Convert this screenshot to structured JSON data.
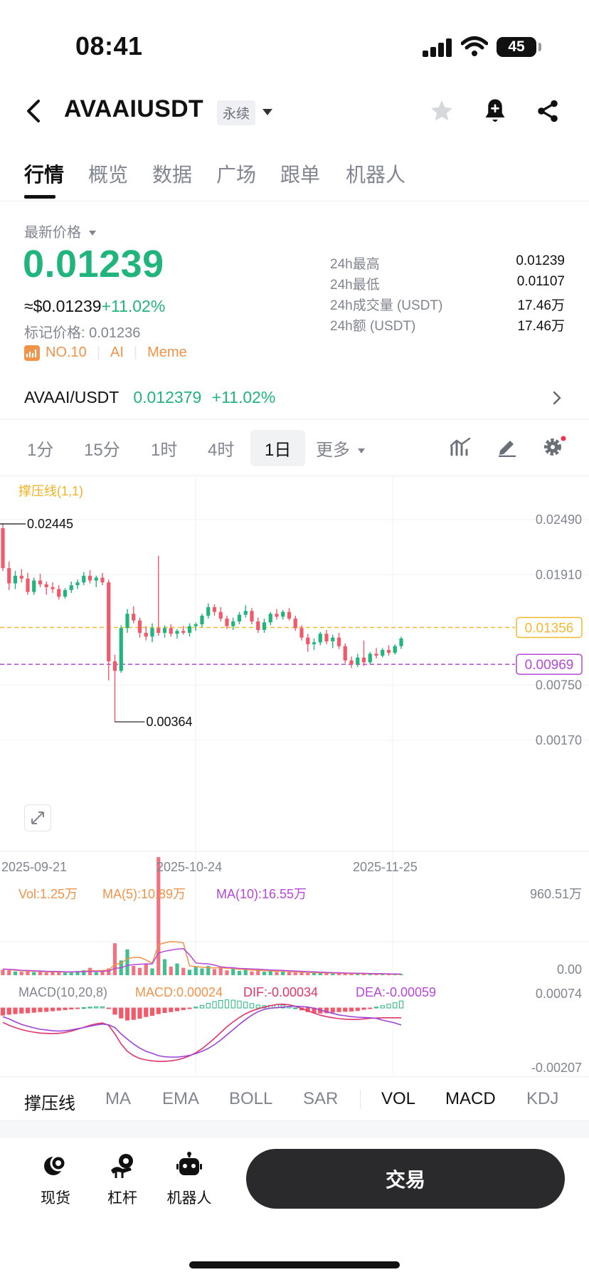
{
  "status": {
    "time": "08:41",
    "battery": "45"
  },
  "header": {
    "title": "AVAAIUSDT",
    "badge": "永续"
  },
  "tabs": [
    {
      "label": "行情"
    },
    {
      "label": "概览"
    },
    {
      "label": "数据"
    },
    {
      "label": "广场"
    },
    {
      "label": "跟单"
    },
    {
      "label": "机器人"
    }
  ],
  "price": {
    "label": "最新价格",
    "last": "0.01239",
    "usd": "≈$0.01239",
    "change": "+11.02%",
    "mark": "标记价格: 0.01236",
    "rank": "NO.10",
    "tag1": "AI",
    "tag2": "Meme"
  },
  "stats": [
    {
      "label": "24h最高",
      "value": "0.01239"
    },
    {
      "label": "24h最低",
      "value": "0.01107"
    },
    {
      "label": "24h成交量 (USDT)",
      "value": "17.46万"
    },
    {
      "label": "24h额 (USDT)",
      "value": "17.46万"
    }
  ],
  "spot": {
    "pair": "AVAAI/USDT",
    "price": "0.012379",
    "change": "+11.02%"
  },
  "timeframes": [
    {
      "label": "1分"
    },
    {
      "label": "15分"
    },
    {
      "label": "1时"
    },
    {
      "label": "4时"
    },
    {
      "label": "1日"
    },
    {
      "label": "更多"
    }
  ],
  "colors": {
    "up": "#21b47d",
    "down": "#f05a6a",
    "resistance": "#f5b82e",
    "support": "#b548d8"
  },
  "chart_data": {
    "type": "candlestick",
    "indicator_label": "撑压线(1,1)",
    "y_ticks": [
      "0.02490",
      "0.01910",
      "0.00750",
      "0.00170"
    ],
    "x_ticks": [
      "2025-09-21",
      "2025-10-24",
      "2025-11-25"
    ],
    "ylim": [
      0.0017,
      0.0249
    ],
    "high_label": "0.02445",
    "low_label": "0.00364",
    "resistance": 0.01356,
    "resistance_label": "0.01356",
    "support": 0.00969,
    "support_label": "0.00969",
    "candles": [
      [
        0.024,
        0.0245,
        0.0195,
        0.0198
      ],
      [
        0.0198,
        0.0205,
        0.0175,
        0.0182
      ],
      [
        0.0182,
        0.0195,
        0.0176,
        0.019
      ],
      [
        0.019,
        0.0197,
        0.0183,
        0.0187
      ],
      [
        0.0187,
        0.0193,
        0.017,
        0.0173
      ],
      [
        0.0173,
        0.0188,
        0.017,
        0.0185
      ],
      [
        0.0185,
        0.0192,
        0.0178,
        0.0181
      ],
      [
        0.0181,
        0.0184,
        0.017,
        0.0178
      ],
      [
        0.0178,
        0.0183,
        0.0172,
        0.0176
      ],
      [
        0.0176,
        0.018,
        0.0165,
        0.0168
      ],
      [
        0.0168,
        0.0177,
        0.0166,
        0.0175
      ],
      [
        0.0175,
        0.0184,
        0.0172,
        0.018
      ],
      [
        0.018,
        0.0186,
        0.0176,
        0.0183
      ],
      [
        0.0183,
        0.0194,
        0.018,
        0.019
      ],
      [
        0.019,
        0.0196,
        0.0182,
        0.0185
      ],
      [
        0.0185,
        0.019,
        0.0178,
        0.0188
      ],
      [
        0.0188,
        0.0193,
        0.018,
        0.0183
      ],
      [
        0.0183,
        0.0186,
        0.008,
        0.01
      ],
      [
        0.01,
        0.0107,
        0.0036,
        0.009
      ],
      [
        0.009,
        0.0138,
        0.0088,
        0.0135
      ],
      [
        0.0135,
        0.0155,
        0.013,
        0.015
      ],
      [
        0.015,
        0.0158,
        0.014,
        0.0143
      ],
      [
        0.0143,
        0.0146,
        0.0125,
        0.013
      ],
      [
        0.013,
        0.0137,
        0.0122,
        0.0126
      ],
      [
        0.0126,
        0.014,
        0.012,
        0.0135
      ],
      [
        0.0135,
        0.0211,
        0.0127,
        0.013
      ],
      [
        0.013,
        0.0138,
        0.0125,
        0.0135
      ],
      [
        0.0135,
        0.0139,
        0.0126,
        0.0129
      ],
      [
        0.0129,
        0.0134,
        0.0124,
        0.0132
      ],
      [
        0.0132,
        0.0137,
        0.0128,
        0.013
      ],
      [
        0.013,
        0.014,
        0.0126,
        0.0137
      ],
      [
        0.0137,
        0.0141,
        0.0132,
        0.0139
      ],
      [
        0.0139,
        0.015,
        0.0136,
        0.0148
      ],
      [
        0.0148,
        0.0161,
        0.0145,
        0.0157
      ],
      [
        0.0157,
        0.016,
        0.0148,
        0.0152
      ],
      [
        0.0152,
        0.0157,
        0.0142,
        0.0145
      ],
      [
        0.0145,
        0.0148,
        0.0134,
        0.0137
      ],
      [
        0.0137,
        0.0146,
        0.0133,
        0.0142
      ],
      [
        0.0142,
        0.0152,
        0.0139,
        0.0149
      ],
      [
        0.0149,
        0.0159,
        0.0146,
        0.0153
      ],
      [
        0.0153,
        0.0156,
        0.0139,
        0.0142
      ],
      [
        0.0142,
        0.0146,
        0.013,
        0.0133
      ],
      [
        0.0133,
        0.0145,
        0.013,
        0.0141
      ],
      [
        0.0141,
        0.0152,
        0.0138,
        0.015
      ],
      [
        0.015,
        0.0155,
        0.0144,
        0.0147
      ],
      [
        0.0147,
        0.0154,
        0.0144,
        0.0152
      ],
      [
        0.0152,
        0.0156,
        0.0143,
        0.0145
      ],
      [
        0.0145,
        0.0148,
        0.0132,
        0.0135
      ],
      [
        0.0135,
        0.0138,
        0.0122,
        0.0125
      ],
      [
        0.0125,
        0.0129,
        0.011,
        0.0118
      ],
      [
        0.0118,
        0.0124,
        0.0112,
        0.012
      ],
      [
        0.012,
        0.0131,
        0.0117,
        0.0129
      ],
      [
        0.0129,
        0.0133,
        0.0118,
        0.0121
      ],
      [
        0.0121,
        0.0128,
        0.0114,
        0.0125
      ],
      [
        0.0125,
        0.013,
        0.0113,
        0.0116
      ],
      [
        0.0116,
        0.0119,
        0.0098,
        0.0101
      ],
      [
        0.0101,
        0.0105,
        0.0093,
        0.0097
      ],
      [
        0.0097,
        0.0108,
        0.0094,
        0.0104
      ],
      [
        0.0104,
        0.0122,
        0.0095,
        0.0099
      ],
      [
        0.0099,
        0.011,
        0.0097,
        0.0108
      ],
      [
        0.0108,
        0.0114,
        0.0103,
        0.0106
      ],
      [
        0.0106,
        0.0114,
        0.0104,
        0.0112
      ],
      [
        0.0112,
        0.0117,
        0.0106,
        0.0109
      ],
      [
        0.0109,
        0.0118,
        0.0107,
        0.0116
      ],
      [
        0.0116,
        0.0126,
        0.0113,
        0.0124
      ]
    ],
    "volume": {
      "vol_label": "Vol:1.25万",
      "ma5_label": "MA(5):10.89万",
      "ma10_label": "MA(10):16.55万",
      "max_label": "960.51万",
      "min_label": "0.00",
      "max": 960.51,
      "values": [
        45,
        40,
        30,
        28,
        35,
        25,
        30,
        22,
        26,
        28,
        20,
        30,
        35,
        40,
        60,
        25,
        30,
        55,
        260,
        120,
        210,
        75,
        60,
        90,
        55,
        960,
        130,
        70,
        95,
        60,
        45,
        70,
        55,
        75,
        50,
        60,
        40,
        55,
        35,
        45,
        30,
        40,
        28,
        32,
        26,
        30,
        25,
        22,
        20,
        18,
        20,
        16,
        18,
        15,
        14,
        12,
        12,
        10,
        10,
        9,
        8,
        8,
        7,
        7,
        6
      ],
      "ma5": [
        50,
        46,
        40,
        36,
        34,
        32,
        31,
        28,
        28,
        27,
        25,
        26,
        29,
        31,
        38,
        36,
        38,
        42,
        86,
        98,
        135,
        144,
        145,
        123,
        98,
        248,
        263,
        273,
        270,
        263,
        76,
        70,
        65,
        61,
        59,
        62,
        56,
        56,
        47,
        47,
        41,
        42,
        36,
        36,
        32,
        33,
        30,
        27,
        25,
        23,
        21,
        19,
        19,
        17,
        17,
        15,
        14,
        13,
        12,
        11,
        10,
        9,
        9,
        8,
        7
      ],
      "ma10": [
        50,
        48,
        45,
        40,
        38,
        36,
        34,
        32,
        31,
        30,
        28,
        28,
        28,
        29,
        31,
        31,
        32,
        35,
        56,
        60,
        80,
        85,
        89,
        92,
        92,
        180,
        195,
        204,
        213,
        215,
        166,
        100,
        95,
        92,
        83,
        68,
        63,
        61,
        55,
        53,
        51,
        49,
        46,
        43,
        41,
        39,
        36,
        34,
        32,
        29,
        27,
        25,
        23,
        21,
        20,
        18,
        17,
        16,
        15,
        14,
        13,
        12,
        11,
        10,
        9
      ]
    },
    "macd": {
      "label": "MACD(10,20,8)",
      "macd_label": "MACD:0.00024",
      "dif_label": "DIF:-0.00034",
      "dea_label": "DEA:-0.00059",
      "max_label": "0.00074",
      "min_label": "-0.00207",
      "ylim": [
        -0.00207,
        0.00074
      ],
      "hist": [
        -0.00025,
        -0.00022,
        -0.0002,
        -0.00018,
        -0.00017,
        -0.00015,
        -0.00013,
        -0.00012,
        -0.0001,
        -8e-05,
        -6e-05,
        -4e-05,
        -2e-05,
        1e-05,
        3e-05,
        4e-05,
        4e-05,
        -2e-05,
        -0.00022,
        -0.00035,
        -0.00042,
        -0.0004,
        -0.00036,
        -0.0003,
        -0.00026,
        -0.0002,
        -0.00016,
        -0.00013,
        -0.0001,
        -6e-05,
        -2e-05,
        3e-05,
        9e-05,
        0.00016,
        0.00022,
        0.00026,
        0.00028,
        0.00027,
        0.00024,
        0.0002,
        0.00015,
        0.0001,
        8e-05,
        9e-05,
        0.00011,
        0.0001,
        6e-05,
        0.0,
        -7e-05,
        -0.00013,
        -0.00017,
        -0.00018,
        -0.00017,
        -0.00015,
        -0.00013,
        -0.00012,
        -0.00011,
        -9e-05,
        -5e-05,
        -1e-05,
        3e-05,
        8e-05,
        0.00013,
        0.00018,
        0.00024
      ],
      "dif": [
        -0.0005,
        -0.0006,
        -0.00068,
        -0.00075,
        -0.0008,
        -0.00084,
        -0.00087,
        -0.00088,
        -0.00089,
        -0.00088,
        -0.00085,
        -0.0008,
        -0.00074,
        -0.00067,
        -0.0006,
        -0.00055,
        -0.00052,
        -0.0006,
        -0.0009,
        -0.00125,
        -0.0015,
        -0.00165,
        -0.00175,
        -0.0018,
        -0.00183,
        -0.00185,
        -0.00185,
        -0.00183,
        -0.0018,
        -0.00174,
        -0.00166,
        -0.00155,
        -0.00141,
        -0.00124,
        -0.00105,
        -0.00085,
        -0.00065,
        -0.00048,
        -0.00033,
        -0.0002,
        -0.0001,
        -3e-05,
        3e-05,
        8e-05,
        0.00012,
        0.00013,
        0.00011,
        6e-05,
        -2e-05,
        -0.0001,
        -0.00018,
        -0.00025,
        -0.0003,
        -0.00034,
        -0.00037,
        -0.00039,
        -0.0004,
        -0.0004,
        -0.00038,
        -0.00036,
        -0.00035,
        -0.00034,
        -0.00034,
        -0.00034,
        -0.00034
      ],
      "dea": [
        -0.0003,
        -0.00038,
        -0.00048,
        -0.00057,
        -0.00063,
        -0.00069,
        -0.00074,
        -0.00076,
        -0.00079,
        -0.0008,
        -0.00079,
        -0.00076,
        -0.00072,
        -0.00068,
        -0.00063,
        -0.00059,
        -0.00056,
        -0.00058,
        -0.00068,
        -0.0009,
        -0.00108,
        -0.00125,
        -0.00139,
        -0.0015,
        -0.00157,
        -0.00165,
        -0.00169,
        -0.0017,
        -0.0017,
        -0.00168,
        -0.00164,
        -0.00158,
        -0.0015,
        -0.0014,
        -0.00127,
        -0.00111,
        -0.00093,
        -0.00075,
        -0.00057,
        -0.0004,
        -0.00025,
        -0.00013,
        -5e-05,
        -1e-05,
        1e-05,
        3e-05,
        5e-05,
        6e-05,
        5e-05,
        3e-05,
        -1e-05,
        -7e-05,
        -0.00013,
        -0.00019,
        -0.00024,
        -0.00027,
        -0.0003,
        -0.00032,
        -0.00033,
        -0.00034,
        -0.00036,
        -0.00042,
        -0.00047,
        -0.00052,
        -0.00059
      ]
    }
  },
  "indicators": [
    {
      "label": "撑压线"
    },
    {
      "label": "MA"
    },
    {
      "label": "EMA"
    },
    {
      "label": "BOLL"
    },
    {
      "label": "SAR"
    },
    {
      "label": "VOL"
    },
    {
      "label": "MACD"
    },
    {
      "label": "KDJ"
    }
  ],
  "bottom_nav": {
    "spot": "现货",
    "margin": "杠杆",
    "bot": "机器人",
    "trade": "交易"
  }
}
